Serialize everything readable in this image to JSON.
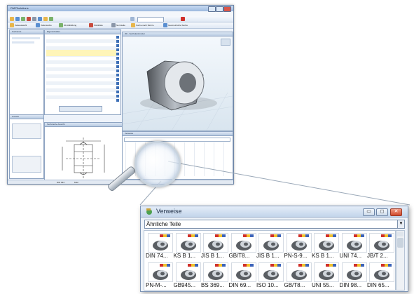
{
  "app": {
    "title": "PARTsolutions",
    "menu": [
      "Datei",
      "Export",
      "Ansicht",
      "Tabelle",
      "Konfiguration",
      "Extras",
      "Fenster",
      "Hilfe"
    ],
    "toolbar_labels": [
      "Teileauswahl",
      "Teilensuche",
      "3D-Abbildung",
      "Stückliste",
      "Normteile",
      "Suche nach Skizze",
      "Geometrische Suche"
    ],
    "panes": {
      "left_top": "Sucheinst.",
      "left_bottom": "Ansicht",
      "table": "Eigenschaften",
      "viewer": "3D - Sechskantmutter",
      "tech": "Technische Ansicht",
      "refs": "Verweise"
    },
    "status": [
      "DIN 934",
      "M12"
    ]
  },
  "verweise": {
    "title": "Verweise",
    "select_value": "Ähnliche Teile",
    "row1": [
      "DIN 74...",
      "KS B 1...",
      "JIS B 1...",
      "GB/T8...",
      "JIS B 1...",
      "PN-S-9...",
      "KS B 1...",
      "UNI 74...",
      "JB/T 2..."
    ],
    "row2": [
      "PN-M-...",
      "GB945...",
      "BS 369...",
      "DIN 69...",
      "ISO 10...",
      "GB/T8...",
      "UNI 55...",
      "DIN 98...",
      "DIN 65..."
    ]
  },
  "colors": {
    "accent": "#3d6fb6",
    "nut_dark": "#5a5e63",
    "nut_light": "#cfd4da",
    "thumb_red": "#d0302a",
    "thumb_yellow": "#f2c32e",
    "thumb_blue": "#3c63b8"
  }
}
